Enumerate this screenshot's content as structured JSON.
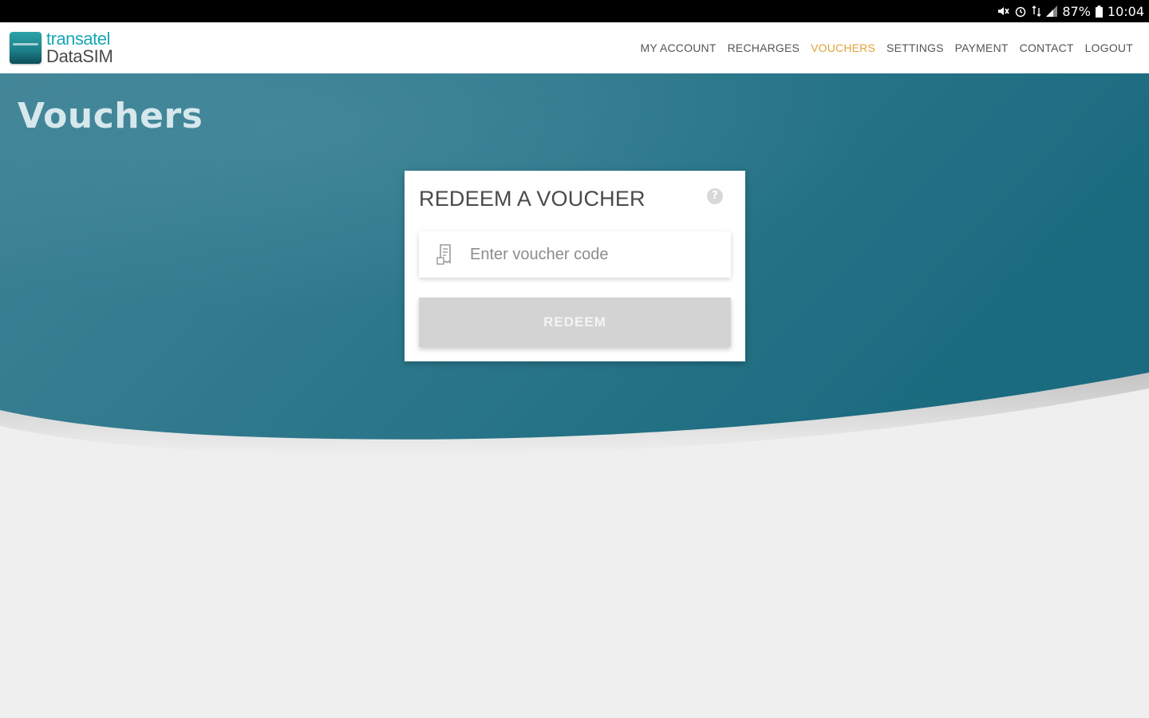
{
  "status_bar": {
    "battery": "87%",
    "time": "10:04",
    "icons": [
      "mute-icon",
      "alarm-icon",
      "data-icon",
      "signal-icon",
      "battery-icon"
    ]
  },
  "header": {
    "logo_top": "transatel",
    "logo_bottom": "DataSIM",
    "nav": [
      {
        "label": "MY ACCOUNT"
      },
      {
        "label": "RECHARGES"
      },
      {
        "label": "VOUCHERS",
        "active": true
      },
      {
        "label": "SETTINGS"
      },
      {
        "label": "PAYMENT"
      },
      {
        "label": "CONTACT"
      },
      {
        "label": "LOGOUT"
      }
    ]
  },
  "page": {
    "title": "Vouchers"
  },
  "card": {
    "title": "REDEEM A VOUCHER",
    "help_icon": "?",
    "input_placeholder": "Enter voucher code",
    "input_value": "",
    "button_label": "REDEEM"
  },
  "colors": {
    "hero_start": "#3f8396",
    "hero_end": "#1b6b80",
    "active_nav": "#e0a339",
    "button_disabled": "#d3d3d3",
    "logo_teal": "#1aa6b7"
  }
}
